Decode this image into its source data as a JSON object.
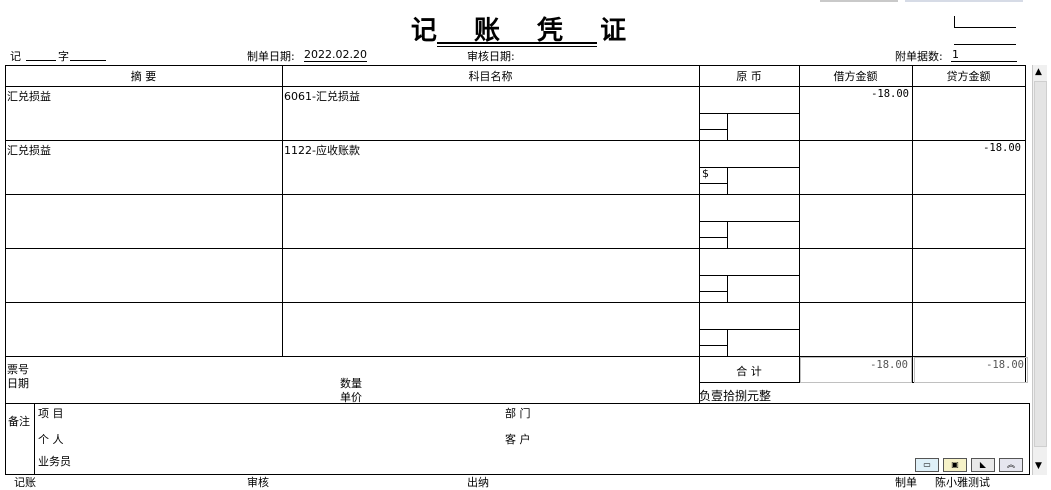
{
  "title": "记 账 凭 证",
  "header": {
    "voucher_prefix": "记",
    "voucher_word": "字",
    "make_date_label": "制单日期:",
    "make_date_value": "2022.02.20",
    "audit_date_label": "审核日期:",
    "attachments_label": "附单据数:",
    "attachments_value": "1"
  },
  "columns": {
    "summary": "摘 要",
    "account": "科目名称",
    "currency": "原 币",
    "debit": "借方金额",
    "credit": "贷方金额"
  },
  "rows": [
    {
      "summary": "汇兑损益",
      "account": "6061-汇兑损益",
      "currency": "",
      "debit": "-18.00",
      "credit": ""
    },
    {
      "summary": "汇兑损益",
      "account": "1122-应收账款",
      "currency": "$",
      "debit": "",
      "credit": "-18.00"
    },
    {
      "summary": "",
      "account": "",
      "currency": "",
      "debit": "",
      "credit": ""
    },
    {
      "summary": "",
      "account": "",
      "currency": "",
      "debit": "",
      "credit": ""
    },
    {
      "summary": "",
      "account": "",
      "currency": "",
      "debit": "",
      "credit": ""
    }
  ],
  "footer": {
    "ticket_no_label": "票号",
    "date_label": "日期",
    "quantity_label": "数量",
    "unit_price_label": "单价",
    "total_label": "合 计",
    "total_debit": "-18.00",
    "total_credit": "-18.00",
    "amount_in_words": "负壹拾捌元整"
  },
  "notes": {
    "label": "备注",
    "project_label": "项 目",
    "department_label": "部 门",
    "person_label": "个 人",
    "customer_label": "客 户",
    "salesman_label": "业务员"
  },
  "bottom_bar": {
    "bookkeeper_label": "记账",
    "auditor_label": "审核",
    "cashier_label": "出纳",
    "maker_label": "制单",
    "maker_name": "陈小雅测试"
  },
  "toolbar_icons": [
    "note-icon",
    "card-icon",
    "chart-icon",
    "collapse-icon"
  ]
}
